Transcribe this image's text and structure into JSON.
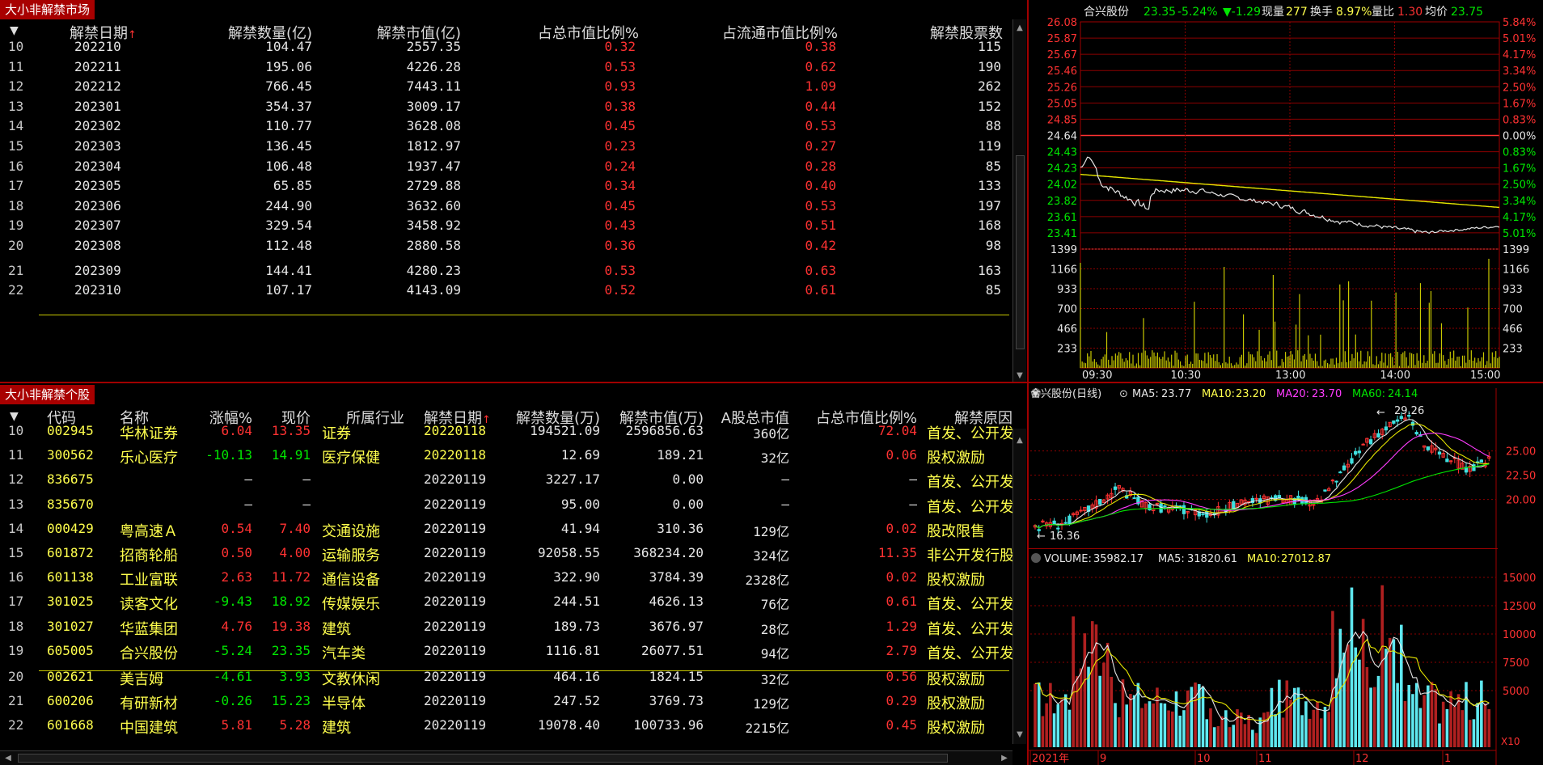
{
  "market": {
    "title": "大小非解禁市场",
    "headers": [
      "解禁日期",
      "解禁数量(亿)",
      "解禁市值(亿)",
      "占总市值比例%",
      "占流通市值比例%",
      "解禁股票数"
    ],
    "sort_arrow": "↑",
    "rows": [
      {
        "idx": "10",
        "date": "202210",
        "qty": "104.47",
        "mv": "2557.35",
        "pct_total": "0.32",
        "pct_float": "0.38",
        "count": "115"
      },
      {
        "idx": "11",
        "date": "202211",
        "qty": "195.06",
        "mv": "4226.28",
        "pct_total": "0.53",
        "pct_float": "0.62",
        "count": "190"
      },
      {
        "idx": "12",
        "date": "202212",
        "qty": "766.45",
        "mv": "7443.11",
        "pct_total": "0.93",
        "pct_float": "1.09",
        "count": "262"
      },
      {
        "idx": "13",
        "date": "202301",
        "qty": "354.37",
        "mv": "3009.17",
        "pct_total": "0.38",
        "pct_float": "0.44",
        "count": "152"
      },
      {
        "idx": "14",
        "date": "202302",
        "qty": "110.77",
        "mv": "3628.08",
        "pct_total": "0.45",
        "pct_float": "0.53",
        "count": "88"
      },
      {
        "idx": "15",
        "date": "202303",
        "qty": "136.45",
        "mv": "1812.97",
        "pct_total": "0.23",
        "pct_float": "0.27",
        "count": "119"
      },
      {
        "idx": "16",
        "date": "202304",
        "qty": "106.48",
        "mv": "1937.47",
        "pct_total": "0.24",
        "pct_float": "0.28",
        "count": "85"
      },
      {
        "idx": "17",
        "date": "202305",
        "qty": "65.85",
        "mv": "2729.88",
        "pct_total": "0.34",
        "pct_float": "0.40",
        "count": "133"
      },
      {
        "idx": "18",
        "date": "202306",
        "qty": "244.90",
        "mv": "3632.60",
        "pct_total": "0.45",
        "pct_float": "0.53",
        "count": "197"
      },
      {
        "idx": "19",
        "date": "202307",
        "qty": "329.54",
        "mv": "3458.92",
        "pct_total": "0.43",
        "pct_float": "0.51",
        "count": "168"
      },
      {
        "idx": "20",
        "date": "202308",
        "qty": "112.48",
        "mv": "2880.58",
        "pct_total": "0.36",
        "pct_float": "0.42",
        "count": "98"
      },
      {
        "idx": "21",
        "date": "202309",
        "qty": "144.41",
        "mv": "4280.23",
        "pct_total": "0.53",
        "pct_float": "0.63",
        "count": "163"
      },
      {
        "idx": "22",
        "date": "202310",
        "qty": "107.17",
        "mv": "4143.09",
        "pct_total": "0.52",
        "pct_float": "0.61",
        "count": "85"
      }
    ]
  },
  "stocks": {
    "title": "大小非解禁个股",
    "headers": [
      "代码",
      "名称",
      "涨幅%",
      "现价",
      "所属行业",
      "解禁日期",
      "解禁数量(万)",
      "解禁市值(万)",
      "A股总市值",
      "占总市值比例%",
      "解禁原因"
    ],
    "sort_arrow": "↑",
    "rows": [
      {
        "idx": "10",
        "code": "002945",
        "name": "华林证券",
        "chg": "6.04",
        "chg_dir": "up",
        "price": "13.35",
        "ind": "证券",
        "date": "20220118",
        "date_hl": true,
        "qty": "194521.09",
        "mv": "2596856.63",
        "cap": "360亿",
        "pct": "72.04",
        "reason": "首发、公开发"
      },
      {
        "idx": "11",
        "code": "300562",
        "name": "乐心医疗",
        "chg": "-10.13",
        "chg_dir": "down",
        "price": "14.91",
        "ind": "医疗保健",
        "date": "20220118",
        "date_hl": true,
        "qty": "12.69",
        "mv": "189.21",
        "cap": "32亿",
        "pct": "0.06",
        "reason": "股权激励"
      },
      {
        "idx": "12",
        "code": "836675",
        "name": "",
        "chg": "–",
        "chg_dir": "none",
        "price": "–",
        "ind": "",
        "date": "20220119",
        "date_hl": false,
        "qty": "3227.17",
        "mv": "0.00",
        "cap": "–",
        "pct": "–",
        "reason": "首发、公开发"
      },
      {
        "idx": "13",
        "code": "835670",
        "name": "",
        "chg": "–",
        "chg_dir": "none",
        "price": "–",
        "ind": "",
        "date": "20220119",
        "date_hl": false,
        "qty": "95.00",
        "mv": "0.00",
        "cap": "–",
        "pct": "–",
        "reason": "首发、公开发"
      },
      {
        "idx": "14",
        "code": "000429",
        "name": "粤高速Ａ",
        "chg": "0.54",
        "chg_dir": "up",
        "price": "7.40",
        "ind": "交通设施",
        "date": "20220119",
        "date_hl": false,
        "qty": "41.94",
        "mv": "310.36",
        "cap": "129亿",
        "pct": "0.02",
        "reason": "股改限售"
      },
      {
        "idx": "15",
        "code": "601872",
        "name": "招商轮船",
        "chg": "0.50",
        "chg_dir": "up",
        "price": "4.00",
        "ind": "运输服务",
        "date": "20220119",
        "date_hl": false,
        "qty": "92058.55",
        "mv": "368234.20",
        "cap": "324亿",
        "pct": "11.35",
        "reason": "非公开发行股"
      },
      {
        "idx": "16",
        "code": "601138",
        "name": "工业富联",
        "chg": "2.63",
        "chg_dir": "up",
        "price": "11.72",
        "ind": "通信设备",
        "date": "20220119",
        "date_hl": false,
        "qty": "322.90",
        "mv": "3784.39",
        "cap": "2328亿",
        "pct": "0.02",
        "reason": "股权激励"
      },
      {
        "idx": "17",
        "code": "301025",
        "name": "读客文化",
        "chg": "-9.43",
        "chg_dir": "down",
        "price": "18.92",
        "ind": "传媒娱乐",
        "date": "20220119",
        "date_hl": false,
        "qty": "244.51",
        "mv": "4626.13",
        "cap": "76亿",
        "pct": "0.61",
        "reason": "首发、公开发"
      },
      {
        "idx": "18",
        "code": "301027",
        "name": "华蓝集团",
        "chg": "4.76",
        "chg_dir": "up",
        "price": "19.38",
        "ind": "建筑",
        "date": "20220119",
        "date_hl": false,
        "qty": "189.73",
        "mv": "3676.97",
        "cap": "28亿",
        "pct": "1.29",
        "reason": "首发、公开发"
      },
      {
        "idx": "19",
        "code": "605005",
        "name": "合兴股份",
        "chg": "-5.24",
        "chg_dir": "down",
        "price": "23.35",
        "ind": "汽车类",
        "date": "20220119",
        "date_hl": false,
        "qty": "1116.81",
        "mv": "26077.51",
        "cap": "94亿",
        "pct": "2.79",
        "reason": "首发、公开发"
      },
      {
        "idx": "20",
        "code": "002621",
        "name": "美吉姆",
        "chg": "-4.61",
        "chg_dir": "down",
        "price": "3.93",
        "ind": "文教休闲",
        "date": "20220119",
        "date_hl": false,
        "qty": "464.16",
        "mv": "1824.15",
        "cap": "32亿",
        "pct": "0.56",
        "reason": "股权激励"
      },
      {
        "idx": "21",
        "code": "600206",
        "name": "有研新材",
        "chg": "-0.26",
        "chg_dir": "down",
        "price": "15.23",
        "ind": "半导体",
        "date": "20220119",
        "date_hl": false,
        "qty": "247.52",
        "mv": "3769.73",
        "cap": "129亿",
        "pct": "0.29",
        "reason": "股权激励"
      },
      {
        "idx": "22",
        "code": "601668",
        "name": "中国建筑",
        "chg": "5.81",
        "chg_dir": "up",
        "price": "5.28",
        "ind": "建筑",
        "date": "20220119",
        "date_hl": false,
        "qty": "19078.40",
        "mv": "100733.96",
        "cap": "2215亿",
        "pct": "0.45",
        "reason": "股权激励"
      }
    ]
  },
  "intraday": {
    "name": "合兴股份",
    "price": "23.35",
    "chg_pct": "-5.24%",
    "chg": "▼-1.29",
    "vol_label": "现量",
    "vol": "277",
    "turnover_label": "换手",
    "turnover": "8.97%",
    "ratio_label": "量比",
    "ratio": "1.30",
    "avg_label": "均价",
    "avg": "23.75",
    "price_ticks": [
      "26.08",
      "25.87",
      "25.67",
      "25.46",
      "25.26",
      "25.05",
      "24.85",
      "24.64",
      "24.43",
      "24.23",
      "24.02",
      "23.82",
      "23.61",
      "23.41"
    ],
    "pct_ticks": [
      "5.84%",
      "5.01%",
      "4.17%",
      "3.34%",
      "2.50%",
      "1.67%",
      "0.83%",
      "0.00%",
      "0.83%",
      "1.67%",
      "2.50%",
      "3.34%",
      "4.17%",
      "5.01%"
    ],
    "vol_ticks": [
      "1399",
      "1166",
      "933",
      "700",
      "466",
      "233"
    ],
    "time_labels": [
      "09:30",
      "10:30",
      "13:00",
      "14:00",
      "15:00"
    ]
  },
  "daily": {
    "name": "合兴股份(日线)",
    "ma5_label": "MA5:",
    "ma5": "23.77",
    "ma10_label": "MA10:",
    "ma10": "23.20",
    "ma20_label": "MA20:",
    "ma20": "23.70",
    "ma60_label": "MA60:",
    "ma60": "24.14",
    "high_mark": "29.26",
    "low_mark": "16.36",
    "price_ticks": [
      "25.00",
      "22.50",
      "20.00"
    ],
    "vol_title": "VOLUME:",
    "vol": "35982.17",
    "vol_ma5_label": "MA5:",
    "vol_ma5": "31820.61",
    "vol_ma10_label": "MA10:",
    "vol_ma10": "27012.87",
    "vol_ticks": [
      "15000",
      "12500",
      "10000",
      "7500",
      "5000"
    ],
    "vol_unit": "X10",
    "date_labels": [
      "2021年",
      "9",
      "10",
      "11",
      "12",
      "1"
    ]
  },
  "colors": {
    "up": "#ff3232",
    "down": "#00e600",
    "hl": "#ffff4d",
    "accent": "#a80000"
  }
}
